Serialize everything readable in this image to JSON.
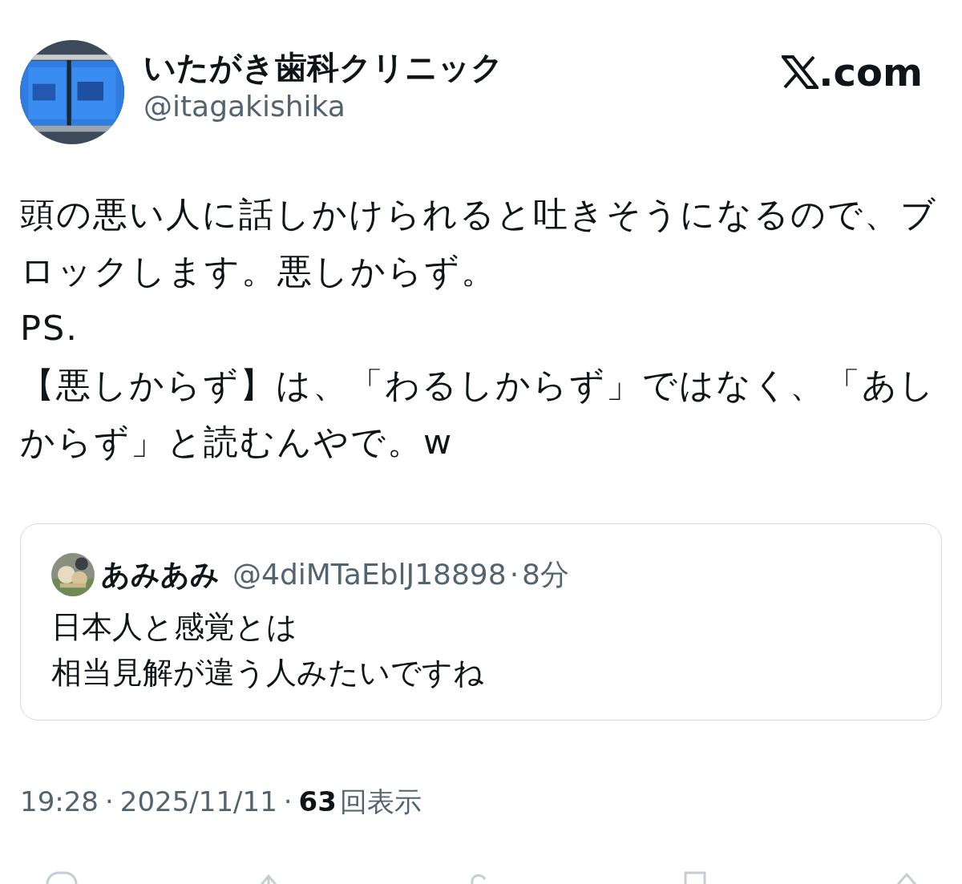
{
  "author": {
    "name": "いたがき歯科クリニック",
    "handle": "@itagakishika"
  },
  "site_logo": {
    "text": ".com"
  },
  "body": {
    "lines": [
      "頭の悪い人に話しかけられると吐きそうになるので、ブロックします。悪しからず。",
      "PS.",
      "【悪しからず】は、「わるしからず」ではなく、「あしからず」と読むんやで。w"
    ]
  },
  "quote": {
    "author": {
      "name": "あみあみ",
      "handle": "@4diMTaEblJ18898"
    },
    "separator": "·",
    "time": "8分",
    "lines": [
      "日本人と感覚とは",
      "相当見解が違う人みたいですね"
    ]
  },
  "meta": {
    "time": "19:28",
    "separator": "·",
    "date": "2025/11/11",
    "views": "63",
    "views_label": "回表示"
  }
}
